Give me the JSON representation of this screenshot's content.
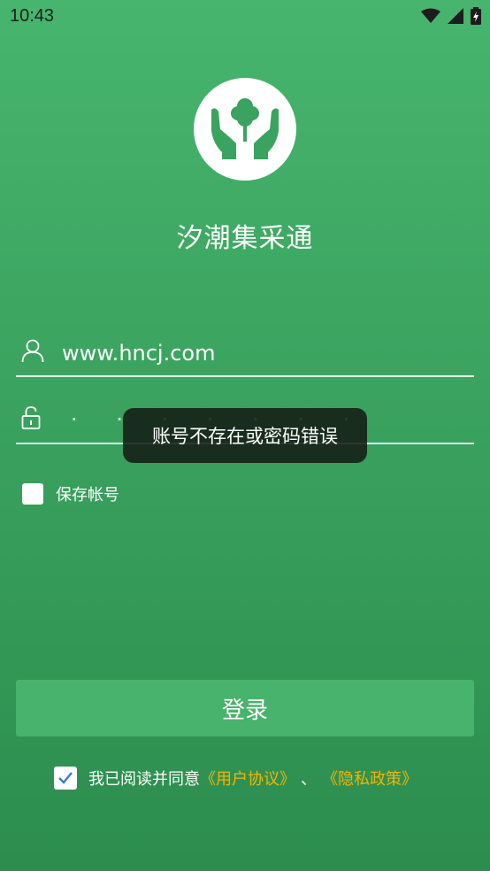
{
  "status_bar": {
    "time": "10:43"
  },
  "app": {
    "title": "汐潮集采通",
    "logo_icon": "tree-in-hands-icon"
  },
  "login_form": {
    "username_value": "www.hncj.com",
    "password_masked": "· · · · · · ·",
    "save_account_label": "保存帐号",
    "save_account_checked": false,
    "login_button_label": "登录"
  },
  "agreement": {
    "checked": true,
    "prefix": "我已阅读并同意",
    "user_agreement": "《用户协议》",
    "separator": "、",
    "privacy_policy": "《隐私政策》"
  },
  "toast": {
    "message": "账号不存在或密码错误"
  },
  "colors": {
    "background": "#3aa35f",
    "button": "#47b36c",
    "link": "#f5b400",
    "icon_green": "#3aa35f"
  }
}
